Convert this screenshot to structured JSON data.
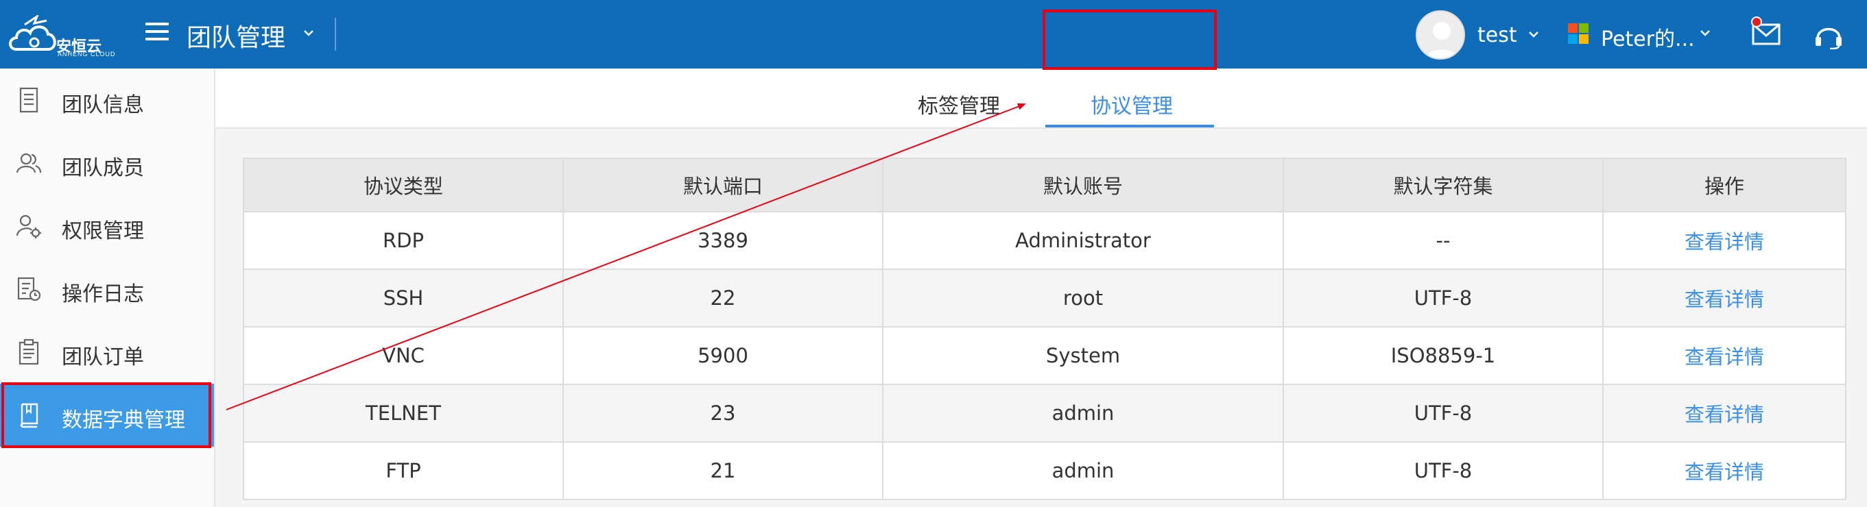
{
  "header": {
    "logo_text": "安恒云",
    "logo_sub": "ANHENG CLOUD",
    "team_title": "团队管理",
    "user_name": "test",
    "org_name": "Peter的...",
    "brand_color": "#0e6cb9"
  },
  "sidebar": {
    "items": [
      {
        "label": "团队信息",
        "icon": "document-icon"
      },
      {
        "label": "团队成员",
        "icon": "users-icon"
      },
      {
        "label": "权限管理",
        "icon": "user-settings-icon"
      },
      {
        "label": "操作日志",
        "icon": "log-icon"
      },
      {
        "label": "团队订单",
        "icon": "clipboard-icon"
      },
      {
        "label": "数据字典管理",
        "icon": "book-icon",
        "active": true
      }
    ],
    "active_color": "#3c9ae6"
  },
  "tabs": [
    {
      "label": "标签管理",
      "active": false
    },
    {
      "label": "协议管理",
      "active": true
    }
  ],
  "table": {
    "columns": [
      "协议类型",
      "默认端口",
      "默认账号",
      "默认字符集",
      "操作"
    ],
    "rows": [
      [
        "RDP",
        "3389",
        "Administrator",
        "--",
        "查看详情"
      ],
      [
        "SSH",
        "22",
        "root",
        "UTF-8",
        "查看详情"
      ],
      [
        "VNC",
        "5900",
        "System",
        "ISO8859-1",
        "查看详情"
      ],
      [
        "TELNET",
        "23",
        "admin",
        "UTF-8",
        "查看详情"
      ],
      [
        "FTP",
        "21",
        "admin",
        "UTF-8",
        "查看详情"
      ]
    ],
    "link_color": "#3a8ee6"
  },
  "annotation": {
    "highlight_color": "#e60012"
  }
}
